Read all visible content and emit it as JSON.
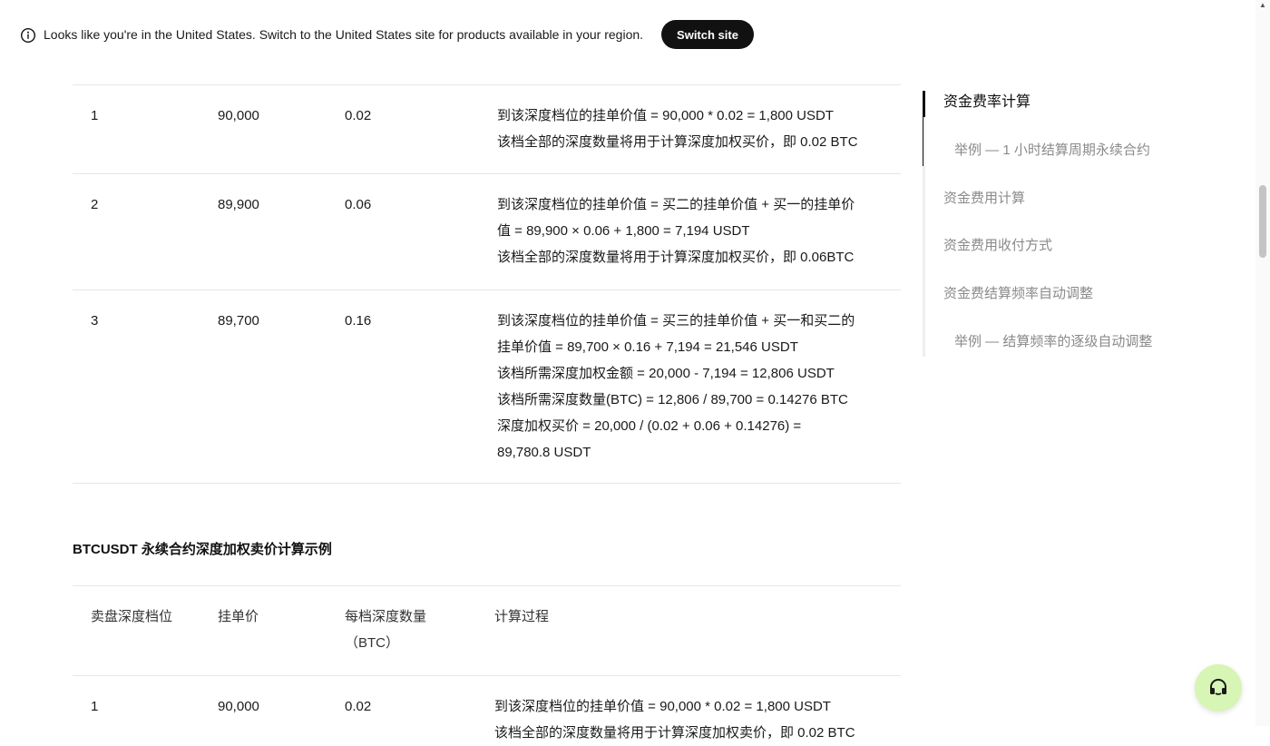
{
  "banner": {
    "message": "Looks like you're in the United States. Switch to the United States site for products available in your region.",
    "switch_label": "Switch site"
  },
  "buy_table": {
    "rows": [
      {
        "level": "1",
        "price": "90,000",
        "qty": "0.02",
        "process": [
          "到该深度档位的挂单价值 = 90,000 * 0.02 = 1,800 USDT",
          "该档全部的深度数量将用于计算深度加权买价，即 0.02 BTC"
        ]
      },
      {
        "level": "2",
        "price": "89,900",
        "qty": "0.06",
        "process": [
          "到该深度档位的挂单价值 = 买二的挂单价值 + 买一的挂单价",
          "值 = 89,900 × 0.06 + 1,800 = 7,194 USDT",
          "该档全部的深度数量将用于计算深度加权买价，即 0.06BTC"
        ]
      },
      {
        "level": "3",
        "price": "89,700",
        "qty": "0.16",
        "process": [
          "到该深度档位的挂单价值 = 买三的挂单价值 + 买一和买二的",
          "挂单价值 = 89,700 × 0.16 + 7,194 = 21,546 USDT",
          "该档所需深度加权金额 = 20,000 - 7,194 = 12,806 USDT",
          "该档所需深度数量(BTC) = 12,806 / 89,700 = 0.14276 BTC",
          "深度加权买价 = 20,000 / (0.02 + 0.06 + 0.14276) =",
          "89,780.8 USDT"
        ]
      }
    ]
  },
  "sell_section": {
    "title": "BTCUSDT 永续合约深度加权卖价计算示例",
    "headers": {
      "level": "卖盘深度档位",
      "price": "挂单价",
      "qty_line1": "每档深度数量",
      "qty_line2": "（BTC）",
      "process": "计算过程"
    },
    "rows": [
      {
        "level": "1",
        "price": "90,000",
        "qty": "0.02",
        "process": [
          "到该深度档位的挂单价值 = 90,000 * 0.02 = 1,800 USDT",
          "该档全部的深度数量将用于计算深度加权卖价，即 0.02 BTC"
        ]
      }
    ]
  },
  "toc": {
    "items": [
      {
        "label": "资金费率计算",
        "active": true
      },
      {
        "label": "举例 — 1 小时结算周期永续合约",
        "active": false
      },
      {
        "label": "资金费用计算",
        "active": false
      },
      {
        "label": "资金费用收付方式",
        "active": false
      },
      {
        "label": "资金费结算频率自动调整",
        "active": false
      },
      {
        "label": "举例 — 结算频率的逐级自动调整",
        "active": false
      }
    ]
  },
  "icons": {
    "info": "info-icon",
    "chat": "headset-icon",
    "scroll_up": "triangle-up-icon"
  },
  "colors": {
    "button_bg": "#111111",
    "chat_bg": "#d7f5b4",
    "toc_muted": "#8a8a8a",
    "rule": "#e6e6e6"
  }
}
